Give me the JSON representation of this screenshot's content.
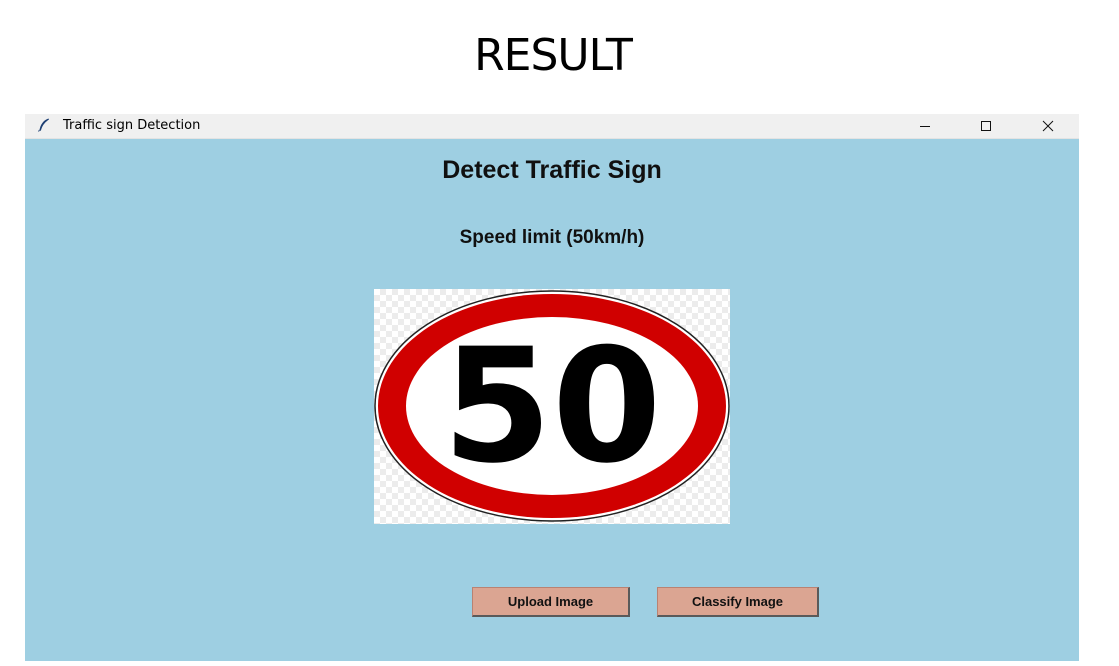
{
  "slide": {
    "title": "RESULT"
  },
  "window": {
    "title": "Traffic sign Detection",
    "background": "#9ecfe2",
    "controls": {
      "minimize_icon": "minimize-icon",
      "maximize_icon": "maximize-icon",
      "close_icon": "close-icon"
    }
  },
  "main": {
    "heading": "Detect Traffic Sign",
    "result": "Speed limit (50km/h)",
    "image": {
      "sign_text": "50",
      "ring_color": "#d00000"
    }
  },
  "buttons": {
    "upload_label": "Upload Image",
    "classify_label": "Classify Image",
    "color": "#dba592"
  }
}
